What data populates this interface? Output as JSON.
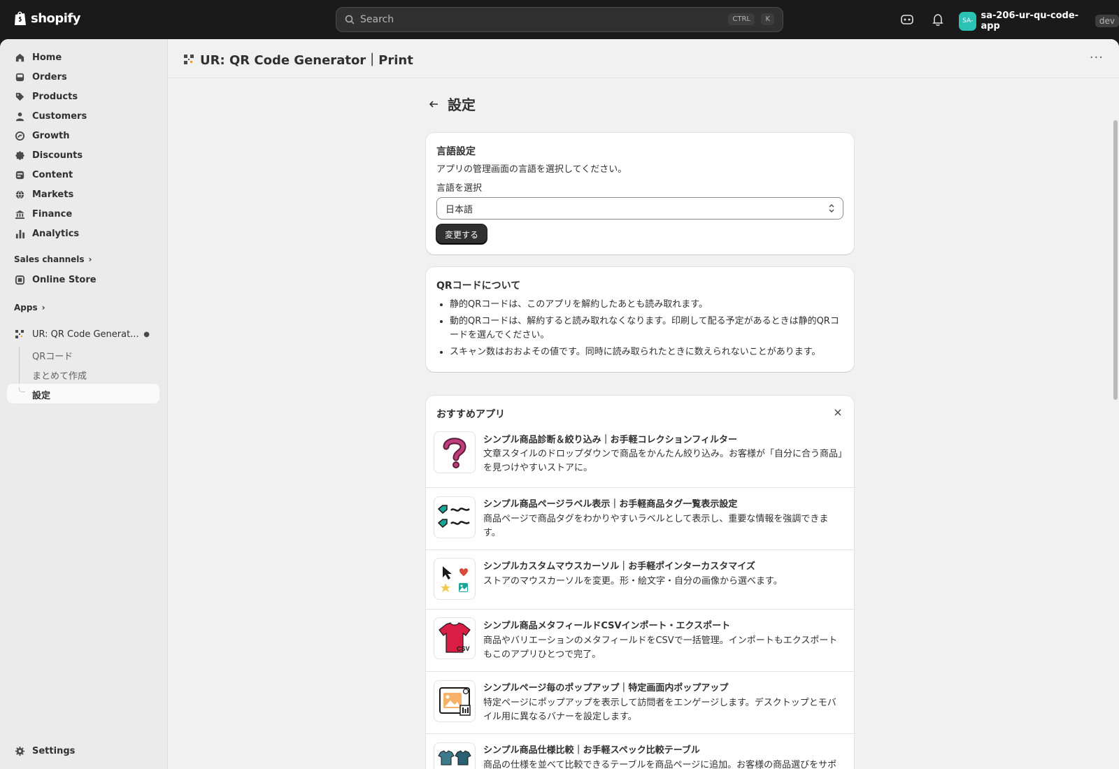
{
  "topbar": {
    "logo_text": "shopify",
    "search_placeholder": "Search",
    "shortcut_key1": "CTRL",
    "shortcut_key2": "K",
    "store_avatar": "SA-",
    "store_name": "sa-206-ur-qu-code-app",
    "store_badge": "dev"
  },
  "sidebar": {
    "items": [
      {
        "label": "Home",
        "icon": "home-icon"
      },
      {
        "label": "Orders",
        "icon": "inbox-icon"
      },
      {
        "label": "Products",
        "icon": "tag-icon"
      },
      {
        "label": "Customers",
        "icon": "person-icon"
      },
      {
        "label": "Growth",
        "icon": "growth-icon"
      },
      {
        "label": "Discounts",
        "icon": "discount-icon"
      },
      {
        "label": "Content",
        "icon": "content-icon"
      },
      {
        "label": "Markets",
        "icon": "globe-icon"
      },
      {
        "label": "Finance",
        "icon": "bank-icon"
      },
      {
        "label": "Analytics",
        "icon": "bar-chart-icon"
      }
    ],
    "sales_channels_label": "Sales channels",
    "online_store_label": "Online Store",
    "apps_label": "Apps",
    "app_name": "UR: QR Code Generat...",
    "app_sub_items": [
      "QRコード",
      "まとめて作成",
      "設定"
    ],
    "settings_label": "Settings"
  },
  "app_header": {
    "title": "UR: QR Code Generator｜Print"
  },
  "page": {
    "title": "設定"
  },
  "language_card": {
    "heading": "言語設定",
    "description": "アプリの管理画面の言語を選択してください。",
    "select_label": "言語を選択",
    "select_value": "日本語",
    "submit_label": "変更する"
  },
  "qr_card": {
    "heading": "QRコードについて",
    "bullets": [
      "静的QRコードは、このアプリを解約したあとも読み取れます。",
      "動的QRコードは、解約すると読み取れなくなります。印刷して配る予定があるときは静的QRコードを選んでください。",
      "スキャン数はおおよその値です。同時に読み取られたときに数えられないことがあります。"
    ]
  },
  "recommend_card": {
    "heading": "おすすめアプリ",
    "apps": [
      {
        "title": "シンプル商品診断＆絞り込み｜お手軽コレクションフィルター",
        "desc": "文章スタイルのドロップダウンで商品をかんたん絞り込み。お客様が「自分に合う商品」を見つけやすいストアに。",
        "icon": "question-mark-icon"
      },
      {
        "title": "シンプル商品ページラベル表示｜お手軽商品タグ一覧表示設定",
        "desc": "商品ページで商品タグをわかりやすいラベルとして表示し、重要な情報を強調できます。",
        "icon": "tag-labels-icon"
      },
      {
        "title": "シンプルカスタムマウスカーソル｜お手軽ポインターカスタマイズ",
        "desc": "ストアのマウスカーソルを変更。形・絵文字・自分の画像から選べます。",
        "icon": "cursor-icon"
      },
      {
        "title": "シンプル商品メタフィールドCSVインポート・エクスポート",
        "desc": "商品やバリエーションのメタフィールドをCSVで一括管理。インポートもエクスポートもこのアプリひとつで完了。",
        "icon": "csv-shirt-icon"
      },
      {
        "title": "シンプルページ毎のポップアップ｜特定画面内ポップアップ",
        "desc": "特定ページにポップアップを表示して訪問者をエンゲージします。デスクトップとモバイル用に異なるバナーを設定します。",
        "icon": "popup-icon"
      },
      {
        "title": "シンプル商品仕様比較｜お手軽スペック比較テーブル",
        "desc": "商品の仕様を並べて比較できるテーブルを商品ページに追加。お客様の商品選びをサポ",
        "icon": "compare-shirts-icon"
      }
    ]
  },
  "colors": {
    "topbar_bg": "#1a1a1a",
    "sidebar_bg": "#ebebeb",
    "main_bg": "#f1f1f1",
    "accent_teal": "#29c2b4",
    "button_dark": "#303030"
  }
}
